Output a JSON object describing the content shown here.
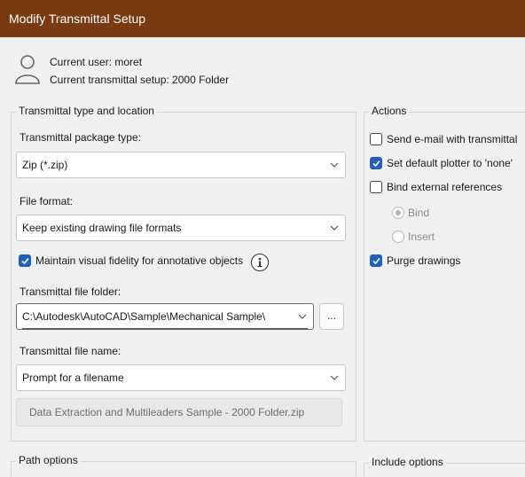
{
  "window": {
    "title": "Modify Transmittal Setup"
  },
  "user": {
    "current_user": "Current user: moret",
    "current_setup": "Current transmittal setup: 2000 Folder"
  },
  "type_location": {
    "group_title": "Transmittal type and location",
    "package_type_label": "Transmittal package type:",
    "package_type_value": "Zip (*.zip)",
    "file_format_label": "File format:",
    "file_format_value": "Keep existing drawing file formats",
    "maintain_fidelity_label": "Maintain visual fidelity for annotative objects",
    "maintain_fidelity_checked": true,
    "folder_label": "Transmittal file folder:",
    "folder_value": "C:\\Autodesk\\AutoCAD\\Sample\\Mechanical Sample\\",
    "browse_label": "...",
    "file_name_label": "Transmittal file name:",
    "file_name_value": "Prompt for a filename",
    "file_name_preview": "Data Extraction and Multileaders Sample - 2000 Folder.zip"
  },
  "actions": {
    "group_title": "Actions",
    "send_email": {
      "label": "Send e-mail with transmittal",
      "checked": false
    },
    "set_plotter": {
      "label": "Set default plotter to 'none'",
      "checked": true
    },
    "bind_xrefs": {
      "label": "Bind external references",
      "checked": false
    },
    "bind_option": {
      "label": "Bind",
      "selected": true
    },
    "insert_option": {
      "label": "Insert",
      "selected": false
    },
    "purge": {
      "label": "Purge drawings",
      "checked": true
    }
  },
  "path_options": {
    "group_title": "Path options"
  },
  "include_options": {
    "group_title": "Include options"
  },
  "icons": {
    "user": "user-icon",
    "dropdown": "chevron-down-icon",
    "info": "info-icon",
    "check": "checkmark-icon"
  },
  "colors": {
    "titlebar": "#7a3a12",
    "checkbox_accent": "#1f5fbf",
    "background": "#f0f0f0"
  }
}
